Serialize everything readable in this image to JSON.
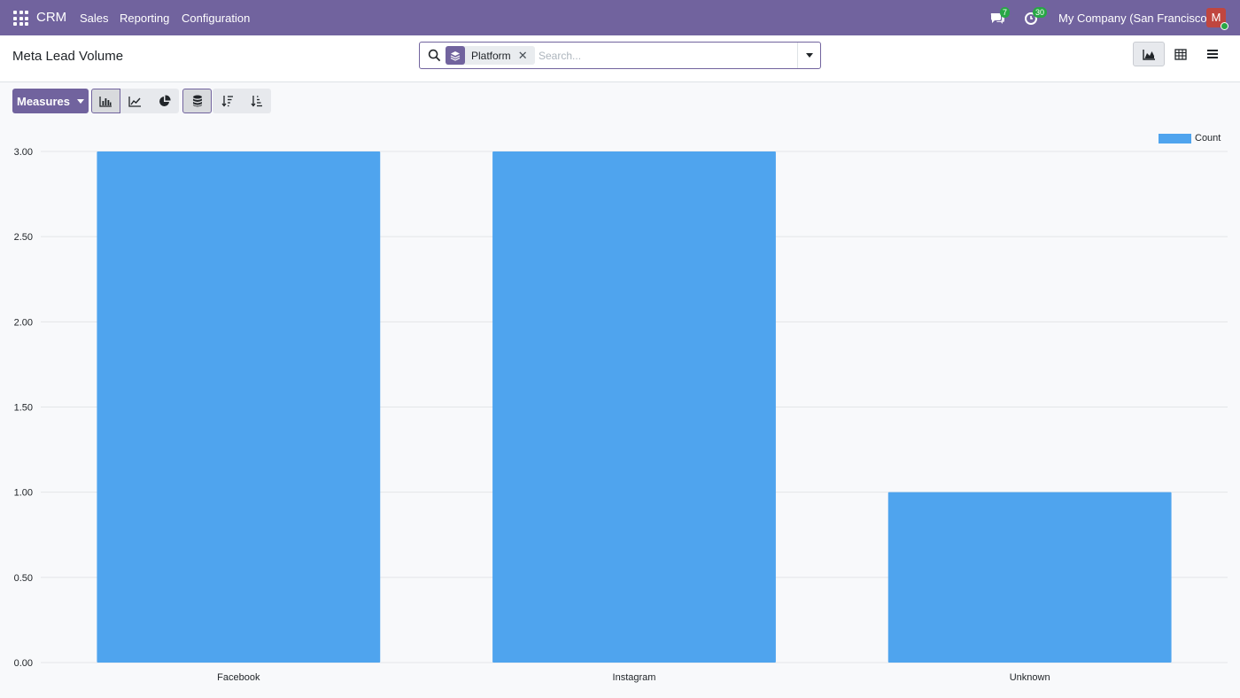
{
  "navbar": {
    "app_name": "CRM",
    "menu": [
      "Sales",
      "Reporting",
      "Configuration"
    ],
    "messages_count": "7",
    "activities_count": "30",
    "company": "My Company (San Francisco)",
    "avatar_letter": "M"
  },
  "control_panel": {
    "title": "Meta Lead Volume",
    "facet_label": "Platform",
    "search_placeholder": "Search..."
  },
  "toolbar": {
    "measures_label": "Measures"
  },
  "colors": {
    "brand": "#71639e",
    "bar": "#4fa4ee",
    "badge": "#28a745"
  },
  "chart_data": {
    "type": "bar",
    "categories": [
      "Facebook",
      "Instagram",
      "Unknown"
    ],
    "series": [
      {
        "name": "Count",
        "values": [
          3,
          3,
          1
        ]
      }
    ],
    "ylim": [
      0,
      3
    ],
    "yticks": [
      "0.00",
      "0.50",
      "1.00",
      "1.50",
      "2.00",
      "2.50",
      "3.00"
    ],
    "grid": true,
    "legend": "top-right"
  }
}
